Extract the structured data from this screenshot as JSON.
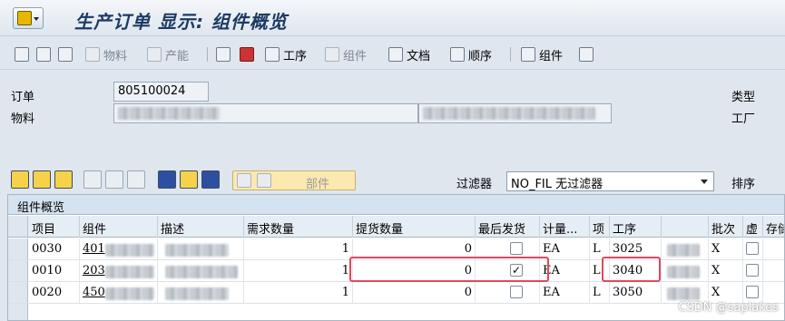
{
  "window": {
    "title": "生产订单 显示: 组件概览"
  },
  "toolbar": {
    "material": "物料",
    "capacity": "产能",
    "operation": "工序",
    "component_disabled": "组件",
    "document": "文档",
    "sequence": "顺序",
    "component": "组件"
  },
  "header": {
    "order_label": "订单",
    "order_value": "805100024",
    "material_label": "物料",
    "type_label": "类型",
    "plant_label": "工厂"
  },
  "table_toolbar": {
    "part_button": "部件",
    "filter_label": "过滤器",
    "filter_value": "NO_FIL 无过滤器",
    "sort_label": "排序"
  },
  "table": {
    "title": "组件概览",
    "columns": [
      "项目",
      "组件",
      "描述",
      "需求数量",
      "提货数量",
      "最后发货",
      "计量...",
      "项",
      "工序",
      "",
      "批次",
      "虚",
      "存储"
    ],
    "rows": [
      {
        "item": "0030",
        "component": "401",
        "required": "1",
        "withdrawn": "0",
        "final_issue": false,
        "uom": "EA",
        "cat": "L",
        "operation": "3025",
        "batch": "X",
        "phantom": false
      },
      {
        "item": "0010",
        "component": "203",
        "required": "1",
        "withdrawn": "0",
        "final_issue": true,
        "uom": "EA",
        "cat": "L",
        "operation": "3040",
        "batch": "X",
        "phantom": false
      },
      {
        "item": "0020",
        "component": "450",
        "required": "1",
        "withdrawn": "0",
        "final_issue": false,
        "uom": "EA",
        "cat": "L",
        "operation": "3050",
        "batch": "X",
        "phantom": false
      }
    ]
  },
  "watermark": "CSDN @saplakes"
}
